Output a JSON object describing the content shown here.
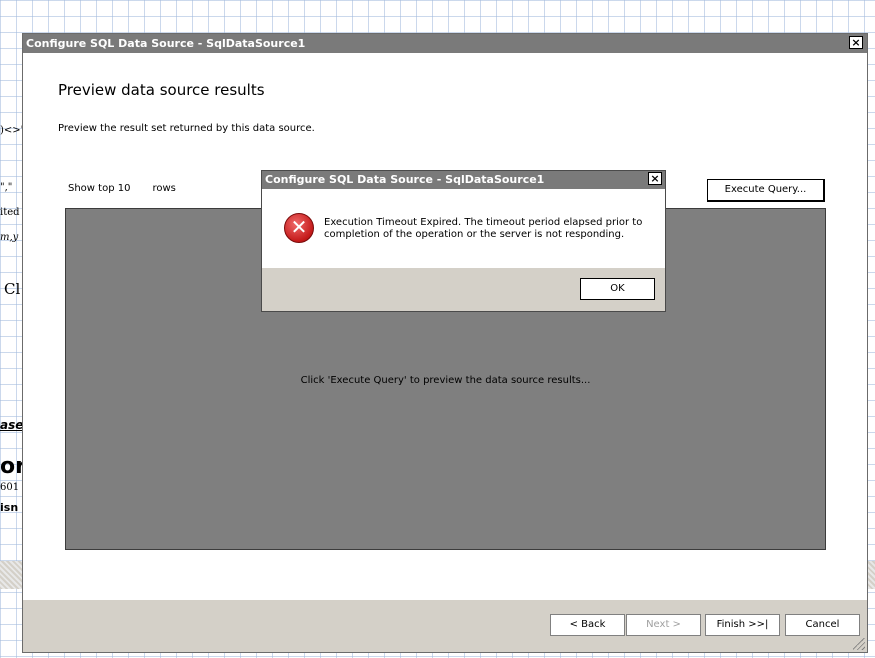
{
  "background": {
    "fragments": [
      ")<>\"",
      "\",\"",
      "ited",
      "m,y",
      "Cl",
      "ase",
      "or",
      "601",
      "isn"
    ]
  },
  "dialog": {
    "title": "Configure SQL Data Source - SqlDataSource1",
    "close_glyph": "×",
    "heading": "Preview data source results",
    "description": "Preview the result set returned by this data source.",
    "show_top_label": "Show top 10",
    "rows_label": "rows",
    "execute_button": "Execute Query...",
    "results_hint": "Click 'Execute Query' to preview the data source results...",
    "footer": {
      "back": "< Back",
      "next": "Next >",
      "finish": "Finish >>|",
      "cancel": "Cancel"
    }
  },
  "error_popup": {
    "title": "Configure SQL Data Source - SqlDataSource1",
    "close_glyph": "×",
    "icon": "error-icon",
    "message": "Execution Timeout Expired.  The timeout period elapsed prior to completion of the operation or the server is not responding.",
    "ok_button": "OK"
  },
  "colors": {
    "titlebar": "#7a7a7a",
    "results_bg": "#7f7f7f",
    "footer_bg": "#d4d0c8",
    "error_red": "#c41a1a"
  }
}
